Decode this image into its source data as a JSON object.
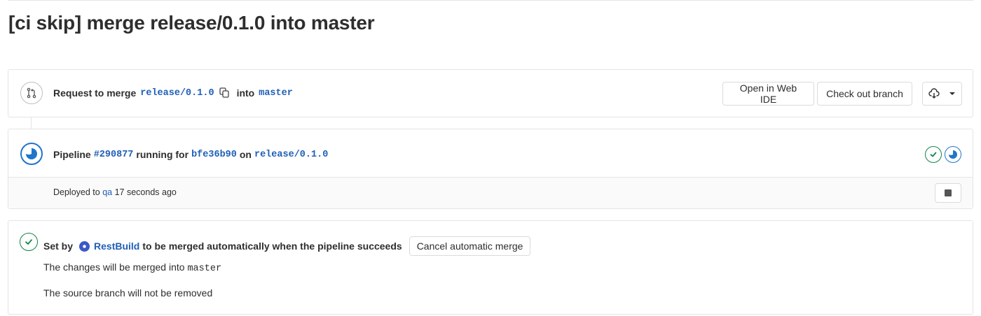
{
  "page": {
    "title": "[ci skip] merge release/0.1.0 into master"
  },
  "request": {
    "prefix": "Request to merge",
    "source_branch": "release/0.1.0",
    "into": "into",
    "target_branch": "master",
    "open_ide_label": "Open in Web IDE",
    "checkout_label": "Check out branch"
  },
  "pipeline": {
    "label": "Pipeline",
    "id": "#290877",
    "running_for": "running for",
    "commit": "bfe36b90",
    "on": "on",
    "branch": "release/0.1.0",
    "stages": [
      {
        "status": "success",
        "color": "#108548"
      },
      {
        "status": "running",
        "color": "#1f75cb"
      }
    ],
    "deploy": {
      "prefix": "Deployed to",
      "environment": "qa",
      "time": "17 seconds ago"
    }
  },
  "merge": {
    "set_by": "Set by",
    "user": "RestBuild",
    "message": "to be merged automatically when the pipeline succeeds",
    "cancel_label": "Cancel automatic merge",
    "changes_text": "The changes will be merged into",
    "changes_branch": "master",
    "source_note": "The source branch will not be removed"
  }
}
